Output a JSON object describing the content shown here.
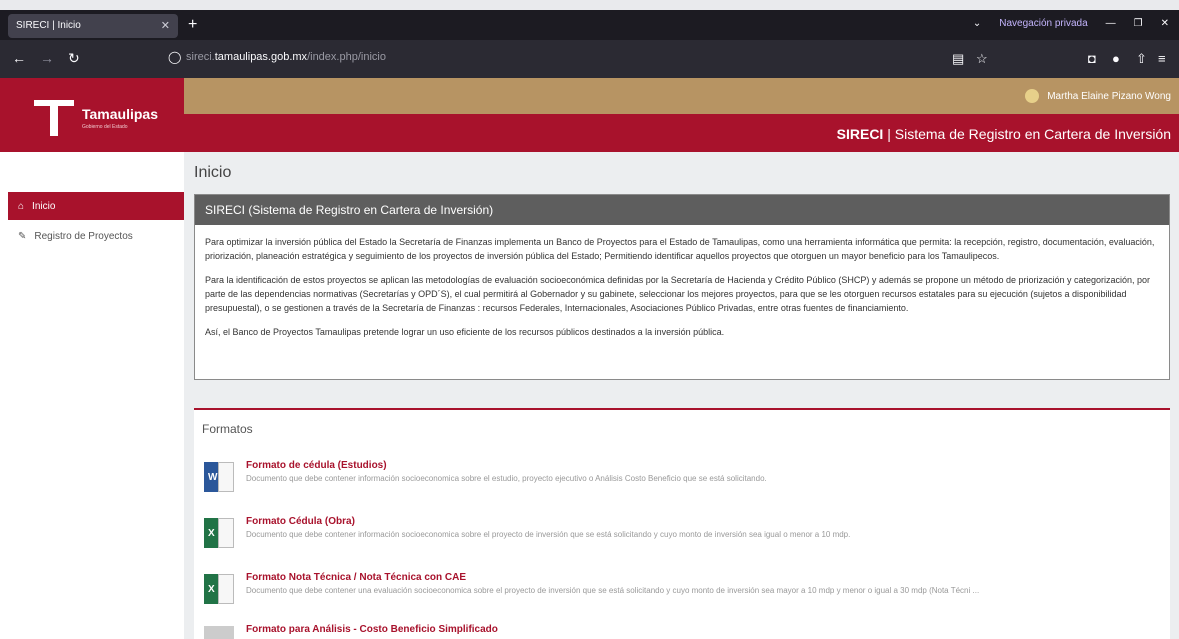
{
  "browser": {
    "tab_title": "SIRECI | Inicio",
    "private_label": "Navegación privada",
    "url_prefix": "sireci.",
    "url_domain": "tamaulipas.gob.mx",
    "url_path": "/index.php/inicio"
  },
  "header": {
    "logo_text": "Tamaulipas",
    "logo_sub": "Gobierno del Estado",
    "user_name": "Martha Elaine Pizano Wong",
    "system_short": "SIRECI",
    "system_full": "Sistema de Registro en Cartera de Inversión"
  },
  "sidebar": {
    "items": [
      {
        "label": "Inicio"
      },
      {
        "label": "Registro de Proyectos"
      }
    ]
  },
  "main": {
    "page_title": "Inicio",
    "panel_title": "SIRECI (Sistema de Registro en Cartera de Inversión)",
    "p1": "Para optimizar la inversión pública del Estado la Secretaría de Finanzas implementa un Banco de Proyectos para el Estado de Tamaulipas, como una herramienta informática que permita: la recepción, registro, documentación, evaluación, priorización, planeación estratégica y seguimiento de los proyectos de inversión pública del Estado; Permitiendo identificar aquellos proyectos que otorguen un mayor beneficio para los Tamaulipecos.",
    "p2": "Para la identificación de estos proyectos se aplican las metodologías de evaluación socioeconómica definidas por la Secretaría de Hacienda y Crédito Público (SHCP) y además se propone un método de priorización y categorización, por parte de las dependencias normativas (Secretarías y OPD´S), el cual permitirá al Gobernador y su gabinete, seleccionar los mejores proyectos, para que se les otorguen recursos estatales para su ejecución (sujetos a disponibilidad presupuestal), o se gestionen a través de la Secretaría de Finanzas : recursos Federales, Internacionales, Asociaciones Público Privadas, entre otras fuentes de financiamiento.",
    "p3": "Así, el Banco de Proyectos Tamaulipas pretende lograr un uso eficiente de los recursos públicos destinados a la inversión pública."
  },
  "formats": {
    "title": "Formatos",
    "items": [
      {
        "title": "Formato de cédula (Estudios)",
        "desc": "Documento que debe contener información socioeconomica sobre el estudio, proyecto ejecutivo o Análisis Costo Beneficio que se está solicitando.",
        "icon": "word-icon"
      },
      {
        "title": "Formato Cédula (Obra)",
        "desc": "Documento que debe contener información socioeconomica sobre el proyecto de inversión que se está solicitando y cuyo monto de inversión sea igual o menor a 10 mdp.",
        "icon": "excel-icon"
      },
      {
        "title": "Formato Nota Técnica / Nota Técnica con CAE",
        "desc": "Documento que debe contener una evaluación socioeconomica sobre el proyecto de inversión que se está solicitando y cuyo monto de inversión sea mayor a 10 mdp y menor o igual a 30 mdp (Nota Técni ...",
        "icon": "excel-icon"
      },
      {
        "title": "Formato para Análisis - Costo Beneficio Simplificado",
        "desc": "",
        "icon": "excel-icon"
      }
    ]
  },
  "colors": {
    "brand": "#a8122c",
    "gold": "#b79463",
    "panel_header": "#5e5e5e"
  }
}
